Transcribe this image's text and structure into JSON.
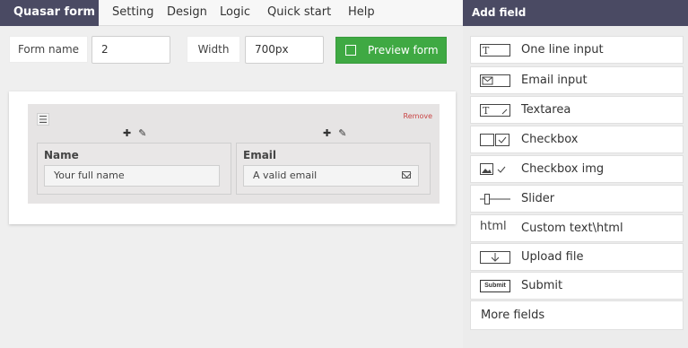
{
  "topbar": {
    "brand": "Quasar form",
    "menu": [
      "Setting",
      "Design",
      "Logic",
      "Quick start",
      "Help"
    ]
  },
  "controls": {
    "form_name_label": "Form name",
    "form_name_value": "2",
    "width_label": "Width",
    "width_value": "700px",
    "preview_label": "Preview form"
  },
  "canvas": {
    "remove_label": "Remove",
    "drag_glyph": "☰",
    "tool_add": "✚",
    "tool_edit": "✎",
    "fields": [
      {
        "label": "Name",
        "placeholder": "Your full name"
      },
      {
        "label": "Email",
        "placeholder": "A valid email"
      }
    ]
  },
  "panel": {
    "title": "Add field",
    "items": [
      {
        "label": "One line input",
        "icon": "text-input-icon"
      },
      {
        "label": "Email input",
        "icon": "email-input-icon"
      },
      {
        "label": "Textarea",
        "icon": "textarea-icon"
      },
      {
        "label": "Checkbox",
        "icon": "checkbox-icon"
      },
      {
        "label": "Checkbox img",
        "icon": "checkbox-img-icon"
      },
      {
        "label": "Slider",
        "icon": "slider-icon"
      },
      {
        "label": "Custom text\\html",
        "icon": "html-icon",
        "icon_text": "html"
      },
      {
        "label": "Upload file",
        "icon": "upload-icon"
      },
      {
        "label": "Submit",
        "icon": "submit-icon",
        "icon_text": "Submit"
      }
    ],
    "more_label": "More fields"
  },
  "colors": {
    "header": "#4a4a63",
    "preview_green": "#3fa943",
    "remove_red": "#c94545"
  }
}
